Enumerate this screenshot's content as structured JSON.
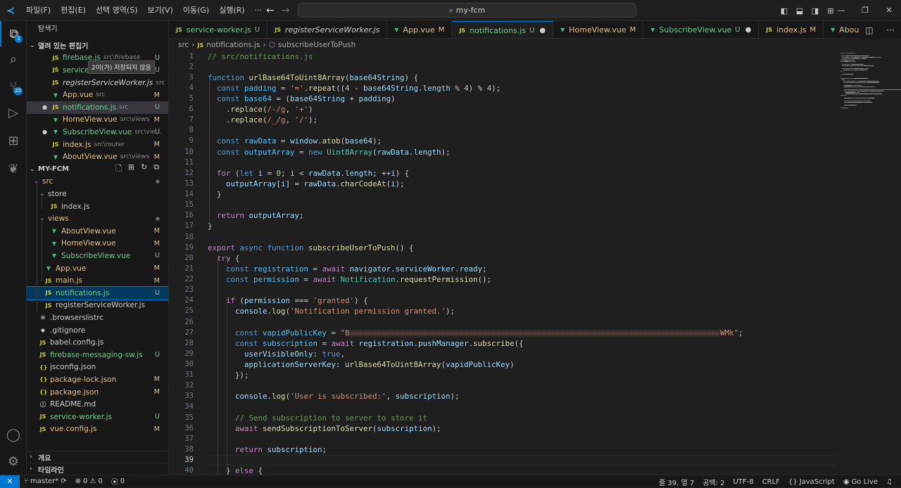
{
  "menu": [
    "파일(F)",
    "편집(E)",
    "선택 영역(S)",
    "보기(V)",
    "이동(G)",
    "실행(R)",
    "···"
  ],
  "search": {
    "text": "my-fcm"
  },
  "sidebar": {
    "title": "탐색기",
    "open_editors_label": "열려 있는 편집기",
    "unsaved_tooltip": "2이(가) 저장되지 않음",
    "open_editors": [
      {
        "name": "firebase.js",
        "dir": "src\\firebase",
        "status": "U",
        "type": "js",
        "dot": false
      },
      {
        "name": "service-worker.js",
        "dir": "",
        "status": "U",
        "type": "js",
        "dot": false
      },
      {
        "name": "registerServiceWorker.js",
        "dir": "src",
        "status": "",
        "type": "js",
        "dot": false
      },
      {
        "name": "App.vue",
        "dir": "src",
        "status": "M",
        "type": "vue",
        "dot": false
      },
      {
        "name": "notifications.js",
        "dir": "src",
        "status": "U",
        "type": "js",
        "dot": true
      },
      {
        "name": "HomeView.vue",
        "dir": "src\\views",
        "status": "M",
        "type": "vue",
        "dot": false
      },
      {
        "name": "SubscribeView.vue",
        "dir": "src\\vie...",
        "status": "U",
        "type": "vue",
        "dot": true
      },
      {
        "name": "index.js",
        "dir": "src\\router",
        "status": "M",
        "type": "js",
        "dot": false
      },
      {
        "name": "AboutView.vue",
        "dir": "src\\views",
        "status": "M",
        "type": "vue",
        "dot": false
      }
    ],
    "project": "MY-FCM",
    "tree": [
      {
        "name": "src",
        "kind": "folder",
        "depth": 0,
        "status": "dot",
        "open": true
      },
      {
        "name": "store",
        "kind": "folder",
        "depth": 1,
        "status": "",
        "open": true
      },
      {
        "name": "index.js",
        "kind": "js",
        "depth": 2,
        "status": ""
      },
      {
        "name": "views",
        "kind": "folder",
        "depth": 1,
        "status": "dot",
        "open": true
      },
      {
        "name": "AboutView.vue",
        "kind": "vue",
        "depth": 2,
        "status": "M"
      },
      {
        "name": "HomeView.vue",
        "kind": "vue",
        "depth": 2,
        "status": "M"
      },
      {
        "name": "SubscribeView.vue",
        "kind": "vue",
        "depth": 2,
        "status": "U"
      },
      {
        "name": "App.vue",
        "kind": "vue",
        "depth": 1,
        "status": "M"
      },
      {
        "name": "main.js",
        "kind": "js",
        "depth": 1,
        "status": "M"
      },
      {
        "name": "notifications.js",
        "kind": "js",
        "depth": 1,
        "status": "U",
        "selected": true
      },
      {
        "name": "registerServiceWorker.js",
        "kind": "js",
        "depth": 1,
        "status": ""
      },
      {
        "name": ".browserslistrc",
        "kind": "cfg",
        "depth": 0,
        "status": ""
      },
      {
        "name": ".gitignore",
        "kind": "git",
        "depth": 0,
        "status": ""
      },
      {
        "name": "babel.config.js",
        "kind": "js",
        "depth": 0,
        "status": ""
      },
      {
        "name": "firebase-messaging-sw.js",
        "kind": "js",
        "depth": 0,
        "status": "U"
      },
      {
        "name": "jsconfig.json",
        "kind": "json",
        "depth": 0,
        "status": ""
      },
      {
        "name": "package-lock.json",
        "kind": "json",
        "depth": 0,
        "status": "M"
      },
      {
        "name": "package.json",
        "kind": "json",
        "depth": 0,
        "status": "M"
      },
      {
        "name": "README.md",
        "kind": "md",
        "depth": 0,
        "status": ""
      },
      {
        "name": "service-worker.js",
        "kind": "js",
        "depth": 0,
        "status": "U"
      },
      {
        "name": "vue.config.js",
        "kind": "js",
        "depth": 0,
        "status": "M"
      }
    ],
    "outline": "개요",
    "timeline": "타임라인"
  },
  "tabs": [
    {
      "name": "service-worker.js",
      "status": "U",
      "type": "js",
      "italic": false,
      "active": false
    },
    {
      "name": "registerServiceWorker.js",
      "status": "",
      "type": "js",
      "italic": true,
      "active": false
    },
    {
      "name": "App.vue",
      "status": "M",
      "type": "vue",
      "italic": false,
      "active": false
    },
    {
      "name": "notifications.js",
      "status": "U",
      "type": "js",
      "italic": false,
      "active": true,
      "dirty": true
    },
    {
      "name": "HomeView.vue",
      "status": "M",
      "type": "vue",
      "italic": false,
      "active": false
    },
    {
      "name": "SubscribeView.vue",
      "status": "U",
      "type": "vue",
      "italic": false,
      "active": false,
      "dirty": true
    },
    {
      "name": "index.js",
      "status": "M",
      "type": "js",
      "italic": false,
      "active": false
    },
    {
      "name": "AboutView.vue",
      "status": "",
      "type": "vue",
      "italic": false,
      "active": false
    }
  ],
  "breadcrumb": {
    "root": "src",
    "file": "notifications.js",
    "symbol": "subscribeUserToPush"
  },
  "editor": {
    "current_line": 39,
    "lines": [
      [
        [
          "cmt",
          "// src/notifications.js"
        ]
      ],
      [],
      [
        [
          "kw",
          "function "
        ],
        [
          "fn",
          "urlBase64ToUint8Array"
        ],
        [
          "p",
          "("
        ],
        [
          "var",
          "base64String"
        ],
        [
          "p",
          ") {"
        ]
      ],
      [
        [
          "p",
          "  "
        ],
        [
          "kw",
          "const "
        ],
        [
          "cst",
          "padding"
        ],
        [
          "p",
          " = "
        ],
        [
          "str",
          "'='"
        ],
        [
          "p",
          "."
        ],
        [
          "fn",
          "repeat"
        ],
        [
          "p",
          "(("
        ],
        [
          "num",
          "4"
        ],
        [
          "p",
          " - "
        ],
        [
          "var",
          "base64String"
        ],
        [
          "p",
          "."
        ],
        [
          "var",
          "length"
        ],
        [
          "p",
          " % "
        ],
        [
          "num",
          "4"
        ],
        [
          "p",
          ") % "
        ],
        [
          "num",
          "4"
        ],
        [
          "p",
          ");"
        ]
      ],
      [
        [
          "p",
          "  "
        ],
        [
          "kw",
          "const "
        ],
        [
          "cst",
          "base64"
        ],
        [
          "p",
          " = ("
        ],
        [
          "var",
          "base64String"
        ],
        [
          "p",
          " + "
        ],
        [
          "var",
          "padding"
        ],
        [
          "p",
          ")"
        ]
      ],
      [
        [
          "p",
          "    ."
        ],
        [
          "fn",
          "replace"
        ],
        [
          "p",
          "("
        ],
        [
          "str",
          "/-/g"
        ],
        [
          "p",
          ", "
        ],
        [
          "str",
          "'+'"
        ],
        [
          "p",
          ")"
        ]
      ],
      [
        [
          "p",
          "    ."
        ],
        [
          "fn",
          "replace"
        ],
        [
          "p",
          "("
        ],
        [
          "str",
          "/_/g"
        ],
        [
          "p",
          ", "
        ],
        [
          "str",
          "'/'"
        ],
        [
          "p",
          ");"
        ]
      ],
      [],
      [
        [
          "p",
          "  "
        ],
        [
          "kw",
          "const "
        ],
        [
          "cst",
          "rawData"
        ],
        [
          "p",
          " = "
        ],
        [
          "var",
          "window"
        ],
        [
          "p",
          "."
        ],
        [
          "fn",
          "atob"
        ],
        [
          "p",
          "("
        ],
        [
          "var",
          "base64"
        ],
        [
          "p",
          ");"
        ]
      ],
      [
        [
          "p",
          "  "
        ],
        [
          "kw",
          "const "
        ],
        [
          "cst",
          "outputArray"
        ],
        [
          "p",
          " = "
        ],
        [
          "kw",
          "new "
        ],
        [
          "cls",
          "Uint8Array"
        ],
        [
          "p",
          "("
        ],
        [
          "var",
          "rawData"
        ],
        [
          "p",
          "."
        ],
        [
          "var",
          "length"
        ],
        [
          "p",
          ");"
        ]
      ],
      [],
      [
        [
          "p",
          "  "
        ],
        [
          "kw2",
          "for "
        ],
        [
          "p",
          "("
        ],
        [
          "kw",
          "let "
        ],
        [
          "var",
          "i"
        ],
        [
          "p",
          " = "
        ],
        [
          "num",
          "0"
        ],
        [
          "p",
          "; "
        ],
        [
          "var",
          "i"
        ],
        [
          "p",
          " < "
        ],
        [
          "var",
          "rawData"
        ],
        [
          "p",
          "."
        ],
        [
          "var",
          "length"
        ],
        [
          "p",
          "; ++"
        ],
        [
          "var",
          "i"
        ],
        [
          "p",
          ") {"
        ]
      ],
      [
        [
          "p",
          "    "
        ],
        [
          "var",
          "outputArray"
        ],
        [
          "p",
          "["
        ],
        [
          "var",
          "i"
        ],
        [
          "p",
          "] = "
        ],
        [
          "var",
          "rawData"
        ],
        [
          "p",
          "."
        ],
        [
          "fn",
          "charCodeAt"
        ],
        [
          "p",
          "("
        ],
        [
          "var",
          "i"
        ],
        [
          "p",
          ");"
        ]
      ],
      [
        [
          "p",
          "  }"
        ]
      ],
      [],
      [
        [
          "p",
          "  "
        ],
        [
          "kw2",
          "return "
        ],
        [
          "var",
          "outputArray"
        ],
        [
          "p",
          ";"
        ]
      ],
      [
        [
          "p",
          "}"
        ]
      ],
      [],
      [
        [
          "kw2",
          "export "
        ],
        [
          "kw",
          "async function "
        ],
        [
          "fn",
          "subscribeUserToPush"
        ],
        [
          "p",
          "() {"
        ]
      ],
      [
        [
          "p",
          "  "
        ],
        [
          "kw2",
          "try "
        ],
        [
          "p",
          "{"
        ]
      ],
      [
        [
          "p",
          "    "
        ],
        [
          "kw",
          "const "
        ],
        [
          "cst",
          "registration"
        ],
        [
          "p",
          " = "
        ],
        [
          "kw2",
          "await "
        ],
        [
          "var",
          "navigator"
        ],
        [
          "p",
          "."
        ],
        [
          "var",
          "serviceWorker"
        ],
        [
          "p",
          "."
        ],
        [
          "var",
          "ready"
        ],
        [
          "p",
          ";"
        ]
      ],
      [
        [
          "p",
          "    "
        ],
        [
          "kw",
          "const "
        ],
        [
          "cst",
          "permission"
        ],
        [
          "p",
          " = "
        ],
        [
          "kw2",
          "await "
        ],
        [
          "cls",
          "Notification"
        ],
        [
          "p",
          "."
        ],
        [
          "fn",
          "requestPermission"
        ],
        [
          "p",
          "();"
        ]
      ],
      [],
      [
        [
          "p",
          "    "
        ],
        [
          "kw2",
          "if "
        ],
        [
          "p",
          "("
        ],
        [
          "var",
          "permission"
        ],
        [
          "p",
          " === "
        ],
        [
          "str",
          "'granted'"
        ],
        [
          "p",
          ") {"
        ]
      ],
      [
        [
          "p",
          "      "
        ],
        [
          "var",
          "console"
        ],
        [
          "p",
          "."
        ],
        [
          "fn",
          "log"
        ],
        [
          "p",
          "("
        ],
        [
          "str",
          "'Notification permission granted.'"
        ],
        [
          "p",
          ");"
        ]
      ],
      [],
      [
        [
          "p",
          "      "
        ],
        [
          "kw",
          "const "
        ],
        [
          "cst",
          "vapidPublicKey"
        ],
        [
          "p",
          " = "
        ],
        [
          "str",
          "\"B"
        ],
        [
          "blur",
          "xxxxxxxxxxxxxxxxxxxxxxxxxxxxxxxxxxxxxxxxxxxxxxxxxxxxxxxxxxxxxxxxxxxxxxxxxxxxxxxxx"
        ],
        [
          "str",
          "WMk\""
        ],
        [
          "p",
          ";"
        ]
      ],
      [
        [
          "p",
          "      "
        ],
        [
          "kw",
          "const "
        ],
        [
          "cst",
          "subscription"
        ],
        [
          "p",
          " = "
        ],
        [
          "kw2",
          "await "
        ],
        [
          "var",
          "registration"
        ],
        [
          "p",
          "."
        ],
        [
          "var",
          "pushManager"
        ],
        [
          "p",
          "."
        ],
        [
          "fn",
          "subscribe"
        ],
        [
          "p",
          "({"
        ]
      ],
      [
        [
          "p",
          "        "
        ],
        [
          "var",
          "userVisibleOnly"
        ],
        [
          "p",
          ": "
        ],
        [
          "kw",
          "true"
        ],
        [
          "p",
          ","
        ]
      ],
      [
        [
          "p",
          "        "
        ],
        [
          "var",
          "applicationServerKey"
        ],
        [
          "p",
          ": "
        ],
        [
          "fn",
          "urlBase64ToUint8Array"
        ],
        [
          "p",
          "("
        ],
        [
          "var",
          "vapidPublicKey"
        ],
        [
          "p",
          ")"
        ]
      ],
      [
        [
          "p",
          "      });"
        ]
      ],
      [],
      [
        [
          "p",
          "      "
        ],
        [
          "var",
          "console"
        ],
        [
          "p",
          "."
        ],
        [
          "fn",
          "log"
        ],
        [
          "p",
          "("
        ],
        [
          "str",
          "'User is subscribed:'"
        ],
        [
          "p",
          ", "
        ],
        [
          "var",
          "subscription"
        ],
        [
          "p",
          ");"
        ]
      ],
      [],
      [
        [
          "p",
          "      "
        ],
        [
          "cmt",
          "// Send subscription to server to store it"
        ]
      ],
      [
        [
          "p",
          "      "
        ],
        [
          "kw2",
          "await "
        ],
        [
          "fn",
          "sendSubscriptionToServer"
        ],
        [
          "p",
          "("
        ],
        [
          "var",
          "subscription"
        ],
        [
          "p",
          ");"
        ]
      ],
      [],
      [
        [
          "p",
          "      "
        ],
        [
          "kw2",
          "return "
        ],
        [
          "var",
          "subscription"
        ],
        [
          "p",
          ";"
        ]
      ],
      [],
      [
        [
          "p",
          "    } "
        ],
        [
          "kw2",
          "else "
        ],
        [
          "p",
          "{"
        ]
      ]
    ]
  },
  "status": {
    "branch": "master*",
    "errors": "0",
    "warnings": "0",
    "ports": "0",
    "position": "줄 39, 열 7",
    "spaces": "공백: 2",
    "encoding": "UTF-8",
    "eol": "CRLF",
    "language": "JavaScript",
    "golive": "Go Live"
  },
  "colors": {
    "accent": "#0078d4",
    "modified": "#e2c08d",
    "untracked": "#73c991"
  }
}
